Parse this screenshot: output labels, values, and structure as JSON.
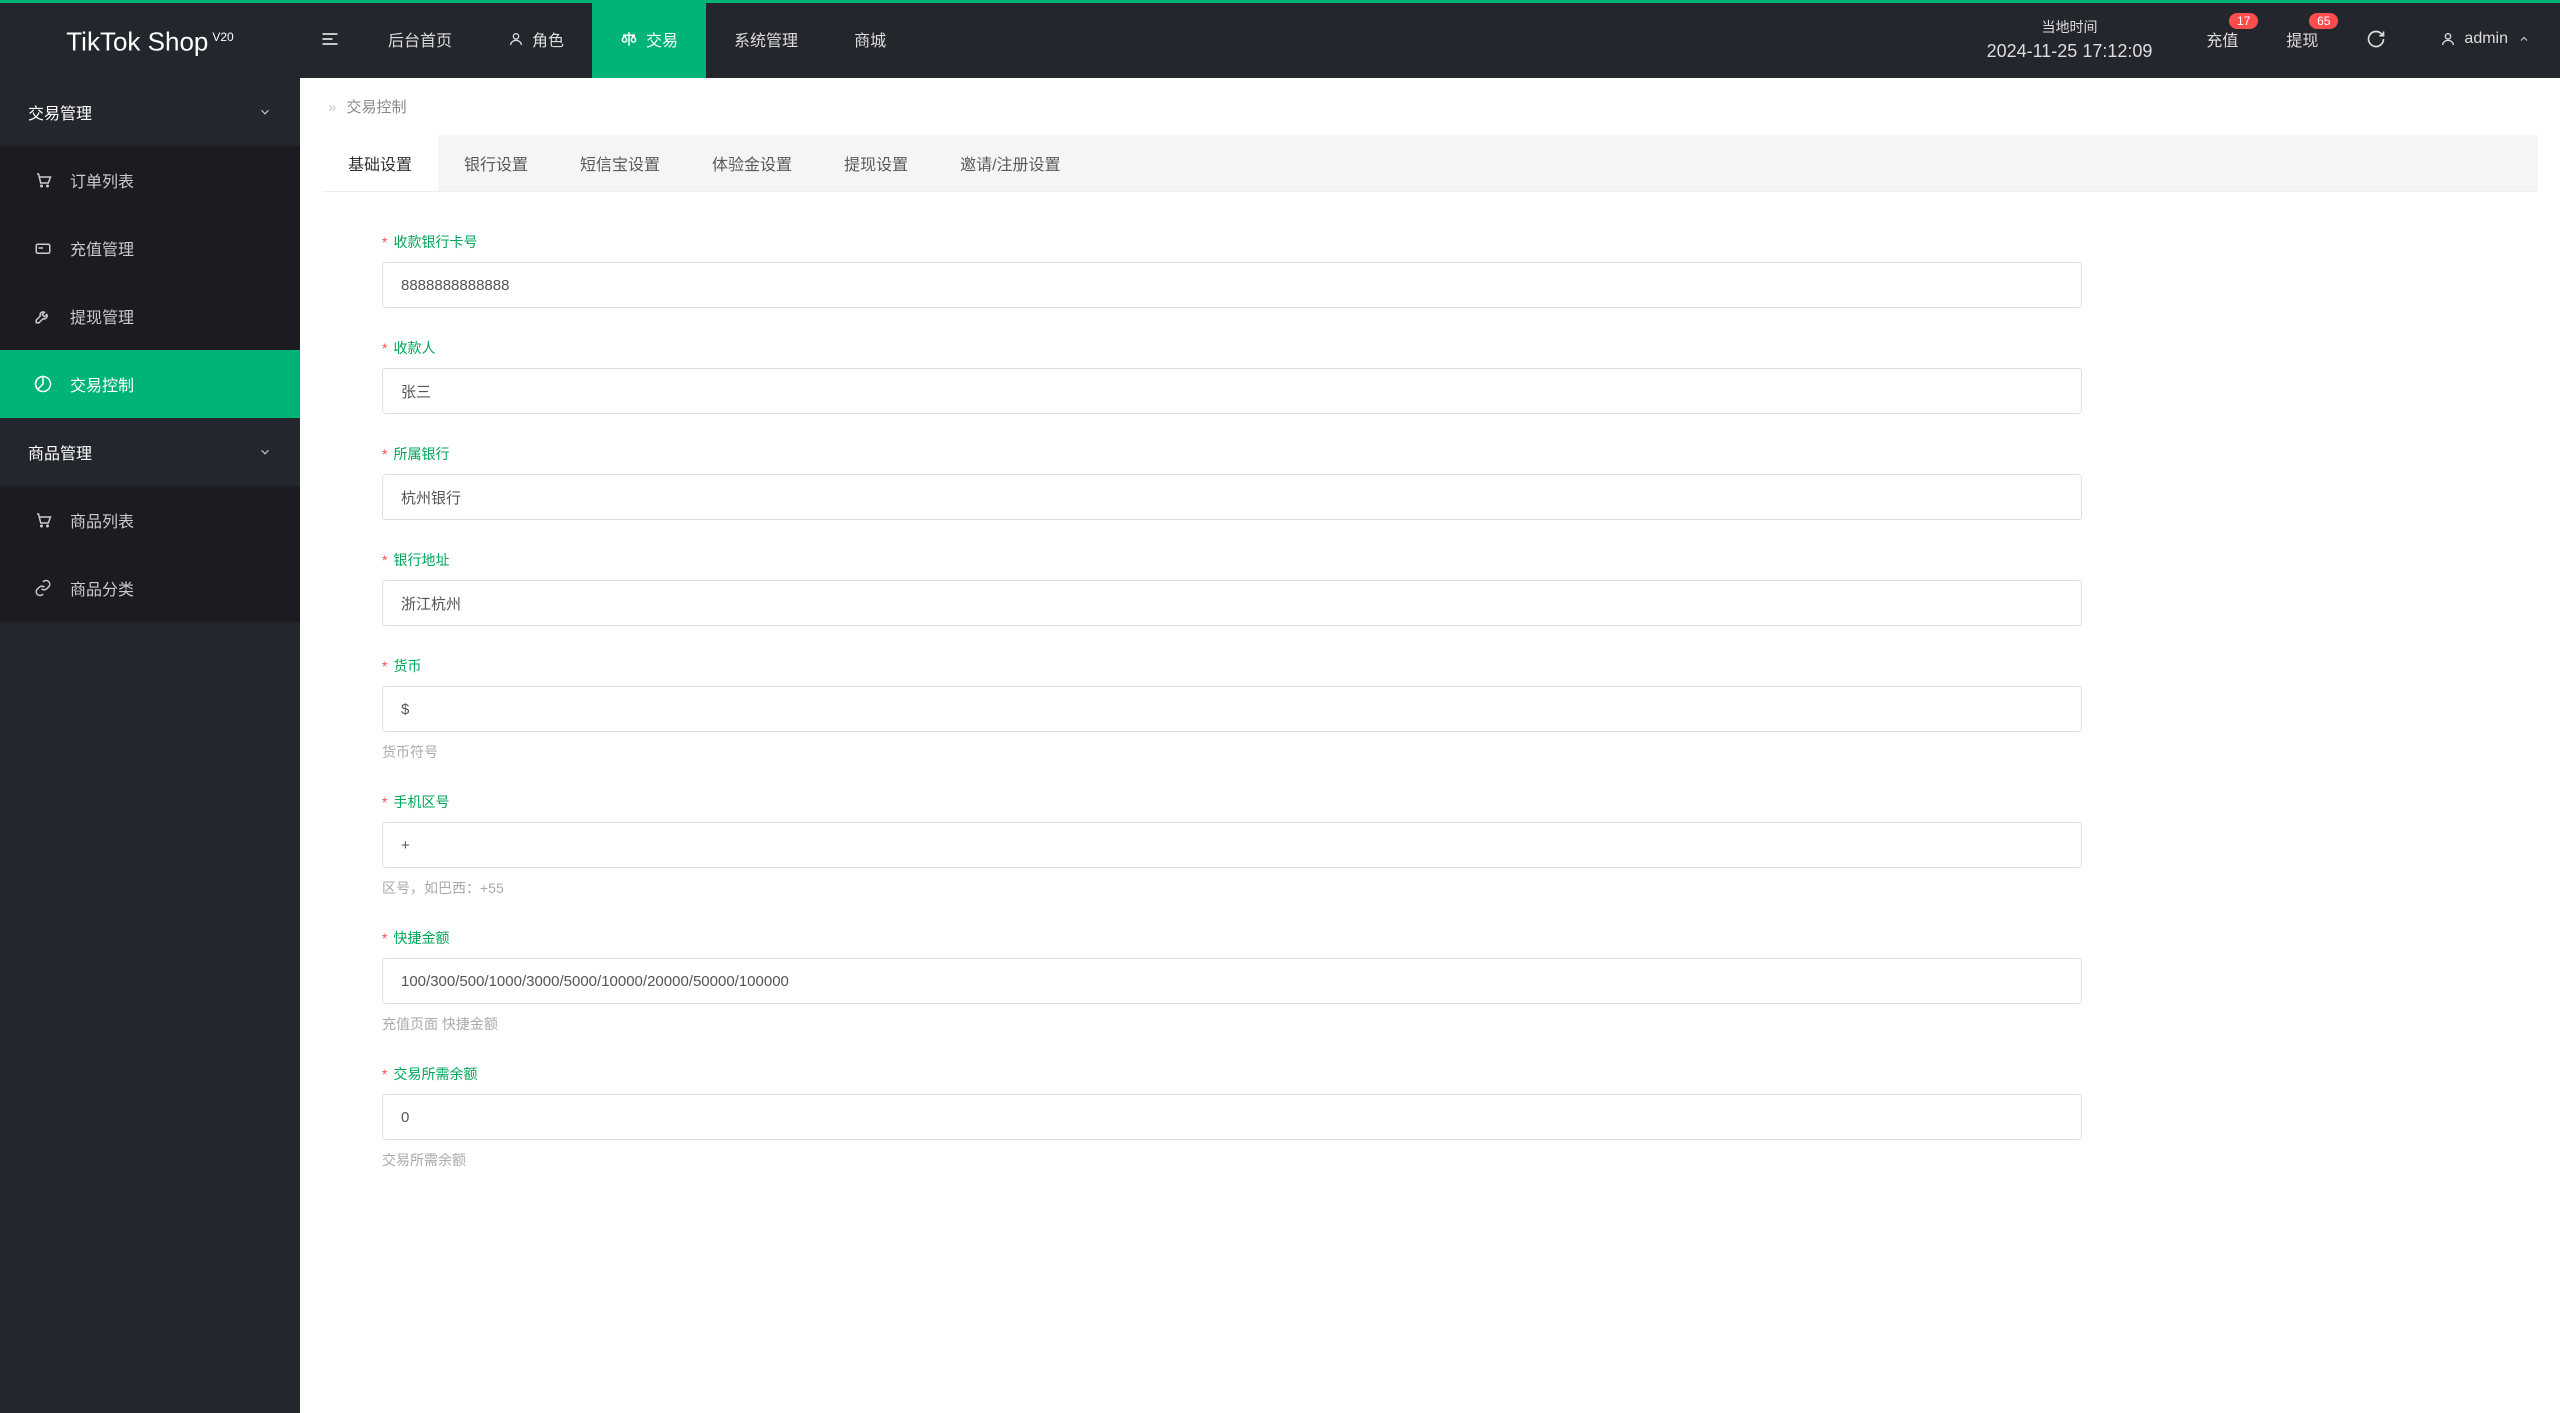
{
  "brand": {
    "name": "TikTok Shop",
    "version": "V20"
  },
  "topnav": {
    "items": [
      {
        "label": "后台首页",
        "active": false
      },
      {
        "label": "角色",
        "active": false,
        "icon": "user"
      },
      {
        "label": "交易",
        "active": true,
        "icon": "scale"
      },
      {
        "label": "系统管理",
        "active": false
      },
      {
        "label": "商城",
        "active": false
      }
    ]
  },
  "clock": {
    "label": "当地时间",
    "time": "2024-11-25 17:12:09"
  },
  "header_actions": {
    "recharge": {
      "label": "充值",
      "badge": "17"
    },
    "withdraw": {
      "label": "提现",
      "badge": "65"
    }
  },
  "user": {
    "name": "admin"
  },
  "sidebar": {
    "groups": [
      {
        "label": "交易管理",
        "items": [
          {
            "label": "订单列表",
            "icon": "cart",
            "active": false
          },
          {
            "label": "充值管理",
            "icon": "recharge",
            "active": false
          },
          {
            "label": "提现管理",
            "icon": "withdraw",
            "active": false
          },
          {
            "label": "交易控制",
            "icon": "dashboard",
            "active": true
          }
        ]
      },
      {
        "label": "商品管理",
        "items": [
          {
            "label": "商品列表",
            "icon": "goods",
            "active": false
          },
          {
            "label": "商品分类",
            "icon": "category",
            "active": false
          }
        ]
      }
    ]
  },
  "breadcrumb": {
    "current": "交易控制"
  },
  "tabs": [
    {
      "label": "基础设置",
      "active": true
    },
    {
      "label": "银行设置",
      "active": false
    },
    {
      "label": "短信宝设置",
      "active": false
    },
    {
      "label": "体验金设置",
      "active": false
    },
    {
      "label": "提现设置",
      "active": false
    },
    {
      "label": "邀请/注册设置",
      "active": false
    }
  ],
  "form": {
    "fields": [
      {
        "label": "收款银行卡号",
        "value": "8888888888888",
        "required": true,
        "help": ""
      },
      {
        "label": "收款人",
        "value": "张三",
        "required": true,
        "help": ""
      },
      {
        "label": "所属银行",
        "value": "杭州银行",
        "required": true,
        "help": ""
      },
      {
        "label": "银行地址",
        "value": "浙江杭州",
        "required": true,
        "help": ""
      },
      {
        "label": "货币",
        "value": "$",
        "required": true,
        "help": "货币符号"
      },
      {
        "label": "手机区号",
        "value": "+",
        "required": true,
        "help": "区号，如巴西：+55"
      },
      {
        "label": "快捷金额",
        "value": "100/300/500/1000/3000/5000/10000/20000/50000/100000",
        "required": true,
        "help": "充值页面 快捷金额"
      },
      {
        "label": "交易所需余额",
        "value": "0",
        "required": true,
        "help": "交易所需余额"
      }
    ]
  }
}
